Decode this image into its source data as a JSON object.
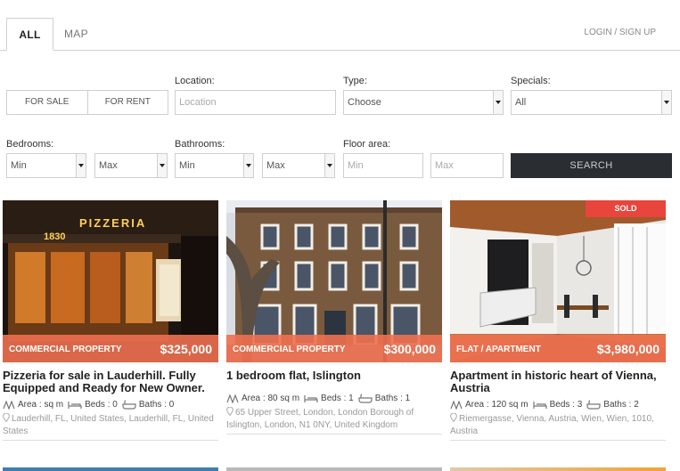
{
  "tabs": {
    "all": "ALL",
    "map": "MAP"
  },
  "login": "LOGIN / SIGN UP",
  "form": {
    "location_label": "Location:",
    "location_placeholder": "Location",
    "type_label": "Type:",
    "type_value": "Choose",
    "specials_label": "Specials:",
    "specials_value": "All",
    "for_sale": "FOR SALE",
    "for_rent": "FOR RENT",
    "bedrooms_label": "Bedrooms:",
    "bedrooms_min": "Min",
    "bedrooms_max": "Max",
    "bathrooms_label": "Bathrooms:",
    "bathrooms_min": "Min",
    "bathrooms_max": "Max",
    "floor_label": "Floor area:",
    "floor_min": "Min",
    "floor_max": "Max",
    "search": "SEARCH"
  },
  "accent_color": "#f07050",
  "sold_color": "#e8453c",
  "listings": [
    {
      "type": "COMMERCIAL PROPERTY",
      "price": "$325,000",
      "title": "Pizzeria for sale in Lauderhill. Fully Equipped and Ready for New Owner.",
      "area": "Area : sq m",
      "beds": "Beds : 0",
      "baths": "Baths : 0",
      "address": "Lauderhill, FL, United States, Lauderhill, FL, United States",
      "sign_text": "PIZZERIA",
      "sign_year": "1830"
    },
    {
      "type": "COMMERCIAL PROPERTY",
      "price": "$300,000",
      "title": "1 bedroom flat, Islington",
      "area": "Area : 80 sq m",
      "beds": "Beds : 1",
      "baths": "Baths : 1",
      "address": "65 Upper Street, London, London Borough of Islington, London, N1 0NY, United Kingdom"
    },
    {
      "type": "FLAT / APARTMENT",
      "price": "$3,980,000",
      "badge": "SOLD",
      "title": "Apartment in historic heart of Vienna, Austria",
      "area": "Area : 120 sq m",
      "beds": "Beds : 3",
      "baths": "Baths : 2",
      "address": "Riemergasse, Vienna, Austria, Wien, Wien, 1010, Austria"
    }
  ]
}
